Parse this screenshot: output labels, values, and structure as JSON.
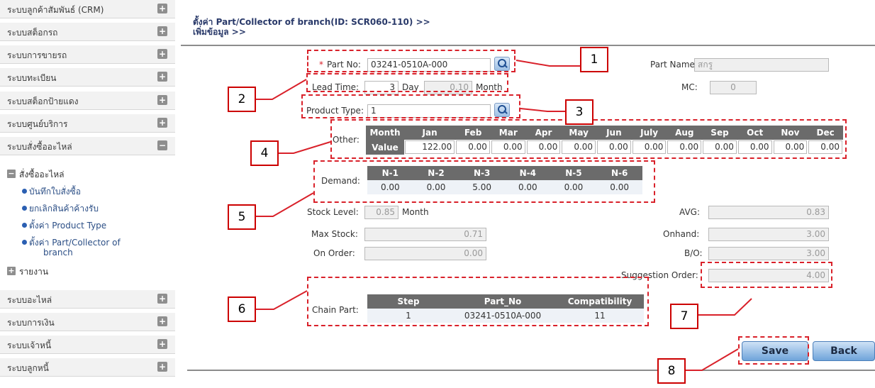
{
  "sidebar": {
    "top_items": [
      {
        "label": "ระบบลูกค้าสัมพันธ์ (CRM)",
        "toggle": "+"
      },
      {
        "label": "ระบบสต็อกรถ",
        "toggle": "+"
      },
      {
        "label": "ระบบการขายรถ",
        "toggle": "+"
      },
      {
        "label": "ระบบทะเบียน",
        "toggle": "+"
      },
      {
        "label": "ระบบสต็อกป้ายแดง",
        "toggle": "+"
      },
      {
        "label": "ระบบศูนย์บริการ",
        "toggle": "+"
      },
      {
        "label": "ระบบสั่งซื้ออะไหล่",
        "toggle": "−"
      }
    ],
    "group": {
      "label": "สั่งซื้ออะไหล่",
      "toggle": "−"
    },
    "sub_items": [
      {
        "label": "บันทึกใบสั่งซื้อ"
      },
      {
        "label": "ยกเลิกสินค้าค้างรับ"
      },
      {
        "label": "ตั้งค่า Product Type"
      },
      {
        "label_line1": "ตั้งค่า Part/Collector of",
        "label_line2": "branch"
      }
    ],
    "report": {
      "label": "รายงาน",
      "toggle": "+"
    },
    "bottom_items": [
      {
        "label": "ระบบอะไหล่",
        "toggle": "+"
      },
      {
        "label": "ระบบการเงิน",
        "toggle": "+"
      },
      {
        "label": "ระบบเจ้าหนี้",
        "toggle": "+"
      },
      {
        "label": "ระบบลูกหนี้",
        "toggle": "+"
      }
    ]
  },
  "page": {
    "title_line1": "ตั้งค่า Part/Collector of branch(ID: SCR060-110) >>",
    "title_line2": "เพิ่มข้อมูล >>"
  },
  "form": {
    "part_no": {
      "required_mark": "*",
      "label": "Part No:",
      "value": "03241-0510A-000"
    },
    "part_name": {
      "label": "Part Name:",
      "value": "สกรู"
    },
    "lead_time": {
      "label": "Lead Time:",
      "value": "3",
      "unit": "Day",
      "month_value": "0.10",
      "month_unit": "Month"
    },
    "mc": {
      "label": "MC:",
      "value": "0"
    },
    "product_type": {
      "label": "Product Type:",
      "value": "1"
    },
    "other": {
      "label": "Other:",
      "row_label_month": "Month",
      "row_label_value": "Value",
      "months": [
        "Jan",
        "Feb",
        "Mar",
        "Apr",
        "May",
        "Jun",
        "July",
        "Aug",
        "Sep",
        "Oct",
        "Nov",
        "Dec"
      ],
      "values": [
        "122.00",
        "0.00",
        "0.00",
        "0.00",
        "0.00",
        "0.00",
        "0.00",
        "0.00",
        "0.00",
        "0.00",
        "0.00",
        "0.00"
      ]
    },
    "demand": {
      "label": "Demand:",
      "headers": [
        "N-1",
        "N-2",
        "N-3",
        "N-4",
        "N-5",
        "N-6"
      ],
      "values": [
        "0.00",
        "0.00",
        "5.00",
        "0.00",
        "0.00",
        "0.00"
      ]
    },
    "stock_level": {
      "label": "Stock Level:",
      "value": "0.85",
      "unit": "Month"
    },
    "avg": {
      "label": "AVG:",
      "value": "0.83"
    },
    "max_stock": {
      "label": "Max Stock:",
      "value": "0.71"
    },
    "onhand": {
      "label": "Onhand:",
      "value": "3.00"
    },
    "on_order": {
      "label": "On Order:",
      "value": "0.00"
    },
    "bo": {
      "label": "B/O:",
      "value": "3.00"
    },
    "suggestion_order": {
      "label": "Suggestion Order:",
      "value": "4.00"
    },
    "chain_part": {
      "label": "Chain Part:",
      "headers": [
        "Step",
        "Part_No",
        "Compatibility"
      ],
      "row": [
        "1",
        "03241-0510A-000",
        "11"
      ]
    }
  },
  "buttons": {
    "save": "Save",
    "back": "Back"
  },
  "callouts": [
    "1",
    "2",
    "3",
    "4",
    "5",
    "6",
    "7",
    "8"
  ],
  "colors": {
    "annotation": "#d9212a",
    "grid_header": "#6b6b6b",
    "sidebar_bg": "#f2f2f2"
  }
}
